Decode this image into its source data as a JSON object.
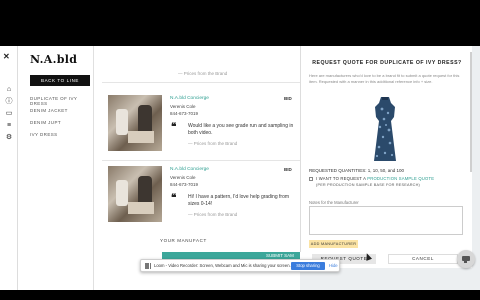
{
  "app": {
    "brand": "N.A.bld"
  },
  "nav": {
    "back_label": "BACK TO LINE",
    "items": [
      {
        "label": "DUPLICATE OF IVY DRESS"
      },
      {
        "label": "DENIM JACKET"
      },
      {
        "label": "DENIM JUPT"
      },
      {
        "label": "IVY DRESS"
      }
    ]
  },
  "main": {
    "from_brand_top": "— Prices from the Brand",
    "cards": [
      {
        "who": "N.A.bld Concierge",
        "name": "Verenis Cole",
        "phone": "844-673-7019",
        "message": "Would like a you see grade run and sampling in both video.",
        "from": "— Prices from the Brand",
        "cut_label": "BID"
      },
      {
        "who": "N.A.bld Concierge",
        "name": "Verenis Cole",
        "phone": "844-673-7019",
        "message": "Hi! I have a pattern, I'd love help grading from sizes 0-14!",
        "from": "— Prices from the Brand",
        "cut_label": "BID"
      }
    ],
    "manufacturers_label": "YOUR MANUFACT",
    "teal_label": "SUBMIT SAM"
  },
  "modal": {
    "title": "REQUEST QUOTE FOR DUPLICATE OF IVY DRESS?",
    "subtitle": "Here are manufacturers who'd love to be a brand fit to submit a quote request for this item. Requested with a manner in this additional reference info + size.",
    "requested_quantities": "REQUESTED QUANTITIES: 1, 10, 50, and 100",
    "want_prefix": "I WANT TO REQUEST A",
    "want_link": "PRODUCTION SAMPLE QUOTE",
    "per_production": "(PER PRODUCTION SAMPLE BASE FOR RESEARCH)",
    "notes_label": "Notes for the Manufacturer",
    "notes_value": "",
    "add_manufacturer": "ADD MANUFACTURER",
    "request_quote": "REQUEST QUOTE",
    "cancel": "CANCEL",
    "accent": "#2a9d8f"
  },
  "loom": {
    "text": "Loom - Video Recorder: Screen, Webcam and Mic is sharing your screen.",
    "stop": "Stop sharing",
    "hide": "Hide"
  }
}
